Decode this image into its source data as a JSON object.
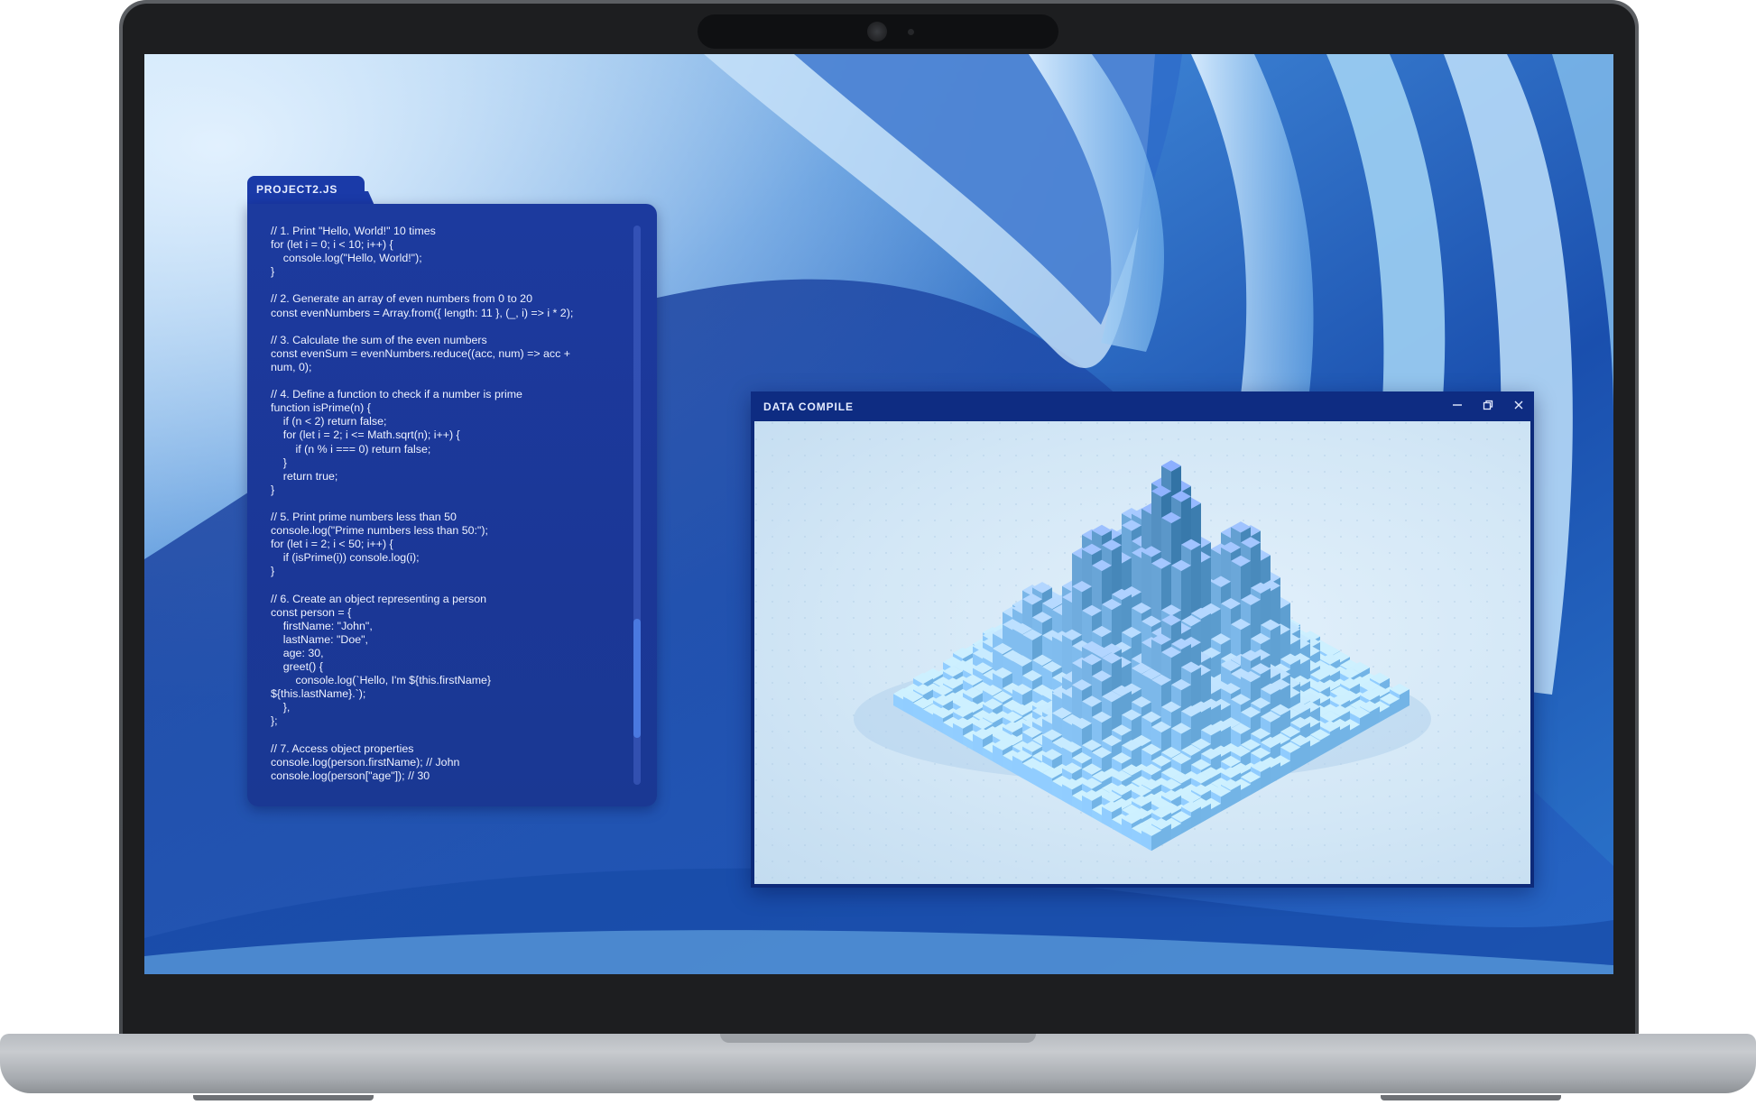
{
  "editor": {
    "tab_label": "PROJECT2.JS",
    "code_lines": [
      "// 1. Print \"Hello, World!\" 10 times",
      "for (let i = 0; i < 10; i++) {",
      "    console.log(\"Hello, World!\");",
      "}",
      "",
      "// 2. Generate an array of even numbers from 0 to 20",
      "const evenNumbers = Array.from({ length: 11 }, (_, i) => i * 2);",
      "",
      "// 3. Calculate the sum of the even numbers",
      "const evenSum = evenNumbers.reduce((acc, num) => acc +",
      "num, 0);",
      "",
      "// 4. Define a function to check if a number is prime",
      "function isPrime(n) {",
      "    if (n < 2) return false;",
      "    for (let i = 2; i <= Math.sqrt(n); i++) {",
      "        if (n % i === 0) return false;",
      "    }",
      "    return true;",
      "}",
      "",
      "// 5. Print prime numbers less than 50",
      "console.log(\"Prime numbers less than 50:\");",
      "for (let i = 2; i < 50; i++) {",
      "    if (isPrime(i)) console.log(i);",
      "}",
      "",
      "// 6. Create an object representing a person",
      "const person = {",
      "    firstName: \"John\",",
      "    lastName: \"Doe\",",
      "    age: 30,",
      "    greet() {",
      "        console.log(`Hello, I'm ${this.firstName}",
      "${this.lastName}.`);",
      "    },",
      "};",
      "",
      "// 7. Access object properties",
      "console.log(person.firstName); // John",
      "console.log(person[\"age\"]); // 30"
    ]
  },
  "data_window": {
    "title": "DATA COMPILE",
    "minimize_icon": "minimize-icon",
    "restore_icon": "restore-icon",
    "close_icon": "close-icon",
    "visualization": "3d-bar-terrain",
    "bar_color": "#5aa7dc"
  },
  "colors": {
    "wallpaper_base": "#1e5bb8",
    "editor_bg": "#1b3797",
    "window_titlebar": "#0e2c82"
  }
}
